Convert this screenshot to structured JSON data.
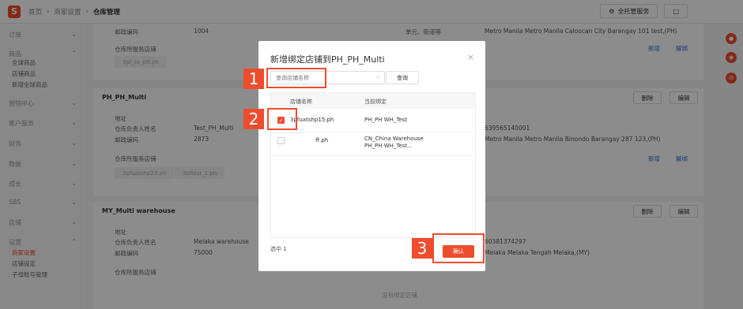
{
  "topbar": {
    "logo": "S",
    "crumbs": [
      "首页",
      "商家设置",
      "仓库管理"
    ],
    "full_service_label": "全托管服务",
    "window_icon": "□"
  },
  "sidebar": {
    "groups": [
      {
        "label": "订单"
      },
      {
        "label": "商品",
        "subs": [
          "全球商品",
          "店铺商品",
          "新增全球商品"
        ]
      },
      {
        "label": "营销中心"
      },
      {
        "label": "客户服务"
      },
      {
        "label": "财务"
      },
      {
        "label": "数据"
      },
      {
        "label": "成长"
      },
      {
        "label": "SBS"
      },
      {
        "label": "店铺"
      },
      {
        "label": "设置",
        "subs": [
          "商家设置",
          "店铺设定",
          "子母账号管理"
        ]
      }
    ]
  },
  "page": {
    "card1": {
      "postal_label": "邮政编码",
      "postal_value": "1004",
      "unit_label": "单元、街道等",
      "address_value": "Metro Manila Metro Manila Caloocan City Barangay 101 test,(PH)",
      "service_label": "仓库所服务店铺",
      "chips": [
        "3pf_to_pff.ph"
      ],
      "add_label": "新增",
      "unbind_label": "解绑"
    },
    "card2": {
      "title": "PH_PH_Multi",
      "delete_label": "删除",
      "edit_label": "编辑",
      "address_label": "地址",
      "manager_label": "仓库负责人姓名",
      "manager_value": "Test_PH_Multi",
      "phone_value": "639565140001",
      "postal_label": "邮政编码",
      "postal_value": "2873",
      "address_value": "Metro Manila Metro Manila Binondo Barangay 287 123,(PH)",
      "service_label": "仓库所服务店铺",
      "chips": [
        "3pfuatshp23.ph",
        "3pRest_1.ph"
      ],
      "add_label": "新增",
      "unbind_label": "解绑"
    },
    "card3": {
      "title": "MY_Multi warehouse",
      "delete_label": "删除",
      "edit_label": "编辑",
      "address_label": "地址",
      "manager_label": "仓库负责人姓名",
      "manager_value": "Melaka warehouse",
      "phone_value": "60381374297",
      "postal_label": "邮政编码",
      "postal_value": "75000",
      "address_value": "Melaka Melaka Tengah Melaka,(MY)",
      "service_label": "仓库所服务店铺",
      "empty_label": "没有绑定店铺"
    }
  },
  "modal": {
    "title": "新增绑定店铺到PH_PH_Multi",
    "close": "×",
    "search_placeholder": "查询店铺名称",
    "query_label": "查询",
    "columns": [
      "店铺名称",
      "当前绑定"
    ],
    "rows": [
      {
        "checked": true,
        "shop": "3pfuatshp15.ph",
        "binding": "PH_PH WH_Test"
      },
      {
        "checked": false,
        "shop": "·ff.ph",
        "binding": "CN_China Warehouse\nPH_PH WH_Test..."
      }
    ],
    "selected_label": "选中 1",
    "confirm_label": "确认"
  },
  "steps": [
    "1",
    "2",
    "3"
  ],
  "colors": {
    "accent": "#ee4d2d",
    "link": "#2673dd"
  }
}
